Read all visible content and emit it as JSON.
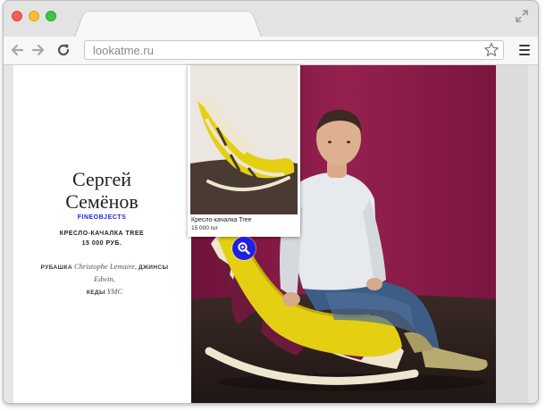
{
  "browser": {
    "url": "lookatme.ru",
    "icons": [
      "close-light",
      "minimize-light",
      "maximize-light",
      "expand-icon",
      "back-arrow-icon",
      "forward-arrow-icon",
      "reload-icon",
      "star-icon",
      "menu-icon"
    ]
  },
  "person": {
    "first_name": "Сергей",
    "last_name": "Семёнов",
    "brand": "FINEOBJECTS",
    "product_name": "КРЕСЛО-КАЧАЛКА TREE",
    "product_price": "15 000 РУБ."
  },
  "outfit": {
    "shirt_label": "РУБАШКА",
    "shirt_brand": "Christophe Lemaire,",
    "jeans_label": "ДЖИНСЫ",
    "jeans_brand": "Edwin,",
    "shoes_label": "КЕДЫ",
    "shoes_brand": "YMC"
  },
  "popup": {
    "title": "Кресло-качалка Tree",
    "price": "15 000 rur"
  },
  "colors": {
    "brand_link": "#2323e6",
    "zoom_button": "#1f1fe6",
    "backdrop": "#8e1b4a",
    "chair_yellow": "#e4cf12"
  }
}
